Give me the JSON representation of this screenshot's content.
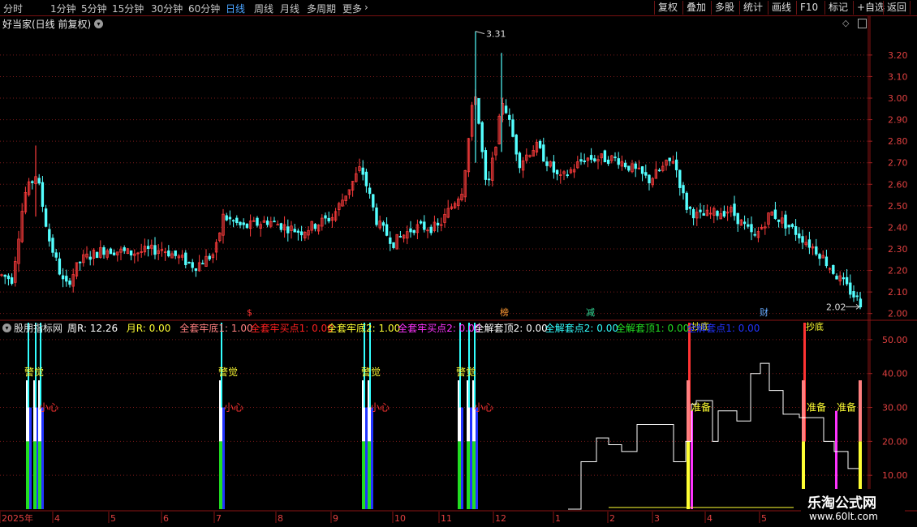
{
  "toolbar": {
    "periods": [
      "分时",
      "1分钟",
      "5分钟",
      "15分钟",
      "30分钟",
      "60分钟",
      "日线",
      "周线",
      "月线",
      "多周期",
      "更多"
    ],
    "active_period": "日线",
    "more_icon": "chevron-right-icon",
    "right_buttons": [
      "复权",
      "叠加",
      "多股",
      "统计",
      "画线",
      "F10",
      "标记",
      "+自选",
      "返回"
    ]
  },
  "main_title": "好当家(日线 前复权)",
  "dropdown_icon": "chevron-down-icon",
  "top_right_icon": "diamond-icon",
  "indicator": {
    "title": "股朋指标网",
    "legend": [
      {
        "text": "周R: 12.26",
        "color": "#ffffff"
      },
      {
        "text": "月R: 0.00",
        "color": "#ffff33"
      },
      {
        "text": "全套牢底1: 1.00",
        "color": "#ff8080"
      },
      {
        "text": "全套牢买点1: 0.00",
        "color": "#ff2020"
      },
      {
        "text": "全套牢底2: 1.00",
        "color": "#ffff33"
      },
      {
        "text": "全套牢买点2: 0.00",
        "color": "#ff33ff"
      },
      {
        "text": "全解套顶2: 0.00",
        "color": "#ffffff"
      },
      {
        "text": "全解套点2: 0.00",
        "color": "#33ffff"
      },
      {
        "text": "全解套顶1: 0.00",
        "color": "#22dd22"
      },
      {
        "text": "全解套点1: 0.00",
        "color": "#2233ff"
      }
    ]
  },
  "chart_data": [
    {
      "type": "candlestick",
      "ylim": [
        1.98,
        3.32
      ],
      "yticks": [
        "3.20",
        "3.10",
        "3.00",
        "2.90",
        "2.80",
        "2.70",
        "2.60",
        "2.50",
        "2.40",
        "2.30",
        "2.20",
        "2.10",
        "2.00"
      ],
      "high_label": "3.31",
      "low_label": "2.02",
      "event_markers": [
        {
          "text": "$",
          "color": "#ff3333"
        },
        {
          "text": "榜",
          "color": "#ff9933"
        },
        {
          "text": "减",
          "color": "#33dd99"
        },
        {
          "text": "财",
          "color": "#66aaff"
        }
      ],
      "colors": {
        "up": "#ff3c3c",
        "down": "#54ffff"
      }
    },
    {
      "type": "indicator",
      "ylim": [
        0,
        55
      ],
      "yticks": [
        "50.00",
        "40.00",
        "30.00",
        "20.00",
        "10.00"
      ],
      "labels": {
        "alert": "警觉",
        "careful": "小心",
        "ready": "准备",
        "bottom": "抄底",
        "rise": "飙"
      }
    }
  ],
  "x_axis": {
    "labels": [
      "2025年",
      "4",
      "5",
      "6",
      "7",
      "8",
      "9",
      "10",
      "11",
      "12",
      "1",
      "2",
      "3",
      "4",
      "5"
    ]
  },
  "watermark": {
    "line1": "乐淘公式网",
    "line2": "www.60lt.com"
  }
}
